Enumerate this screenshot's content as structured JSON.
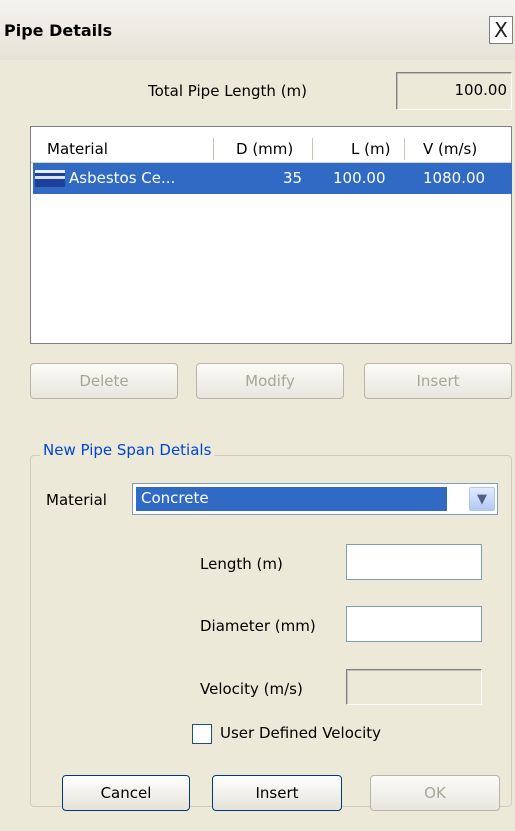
{
  "window": {
    "title": "Pipe Details",
    "close_glyph": "X"
  },
  "total": {
    "label": "Total Pipe Length (m)",
    "value": "100.00"
  },
  "table": {
    "columns": [
      "Material",
      "D (mm)",
      "L (m)",
      "V (m/s)"
    ],
    "rows": [
      {
        "material": "Asbestos Ce...",
        "d": "35",
        "l": "100.00",
        "v": "1080.00",
        "selected": true
      }
    ]
  },
  "list_buttons": {
    "delete": "Delete",
    "modify": "Modify",
    "insert": "Insert"
  },
  "new_span": {
    "group_title": "New Pipe Span Detials",
    "material_label": "Material",
    "material_value": "Concrete",
    "length_label": "Length (m)",
    "length_value": "",
    "diameter_label": "Diameter (mm)",
    "diameter_value": "",
    "velocity_label": "Velocity (m/s)",
    "velocity_value": "",
    "user_defined_label": "User Defined Velocity",
    "user_defined_checked": false
  },
  "footer": {
    "cancel": "Cancel",
    "insert": "Insert",
    "ok": "OK"
  },
  "colors": {
    "selection": "#316ac5",
    "group_title": "#0046d5",
    "background": "#ece9d8"
  },
  "icons": {
    "close": "close-icon",
    "row": "pipe-row-icon",
    "dropdown": "chevron-down-icon"
  }
}
